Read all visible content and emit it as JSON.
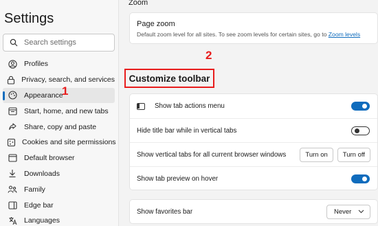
{
  "sidebar": {
    "title": "Settings",
    "search_placeholder": "Search settings",
    "items": [
      {
        "label": "Profiles",
        "icon": "profile-icon"
      },
      {
        "label": "Privacy, search, and services",
        "icon": "lock-icon"
      },
      {
        "label": "Appearance",
        "icon": "appearance-icon",
        "active": true
      },
      {
        "label": "Start, home, and new tabs",
        "icon": "start-icon"
      },
      {
        "label": "Share, copy and paste",
        "icon": "share-icon"
      },
      {
        "label": "Cookies and site permissions",
        "icon": "cookies-icon"
      },
      {
        "label": "Default browser",
        "icon": "browser-icon"
      },
      {
        "label": "Downloads",
        "icon": "download-icon"
      },
      {
        "label": "Family",
        "icon": "family-icon"
      },
      {
        "label": "Edge bar",
        "icon": "edge-bar-icon"
      },
      {
        "label": "Languages",
        "icon": "languages-icon"
      }
    ]
  },
  "annotations": {
    "one": "1",
    "two": "2"
  },
  "main": {
    "zoom_heading": "Zoom",
    "page_zoom": {
      "title": "Page zoom",
      "description": "Default zoom level for all sites. To see zoom levels for certain sites, go to",
      "link": "Zoom levels"
    },
    "section_title": "Customize toolbar",
    "rows": [
      {
        "label": "Show tab actions menu",
        "toggle": "on"
      },
      {
        "label": "Hide title bar while in vertical tabs",
        "toggle": "off"
      },
      {
        "label": "Show vertical tabs for all current browser windows",
        "turn_on": "Turn on",
        "turn_off": "Turn off"
      },
      {
        "label": "Show tab preview on hover",
        "toggle": "on"
      }
    ],
    "favorites": {
      "label": "Show favorites bar",
      "value": "Never"
    }
  },
  "colors": {
    "accent": "#0f6cbd",
    "annotation": "#e81c1c"
  }
}
